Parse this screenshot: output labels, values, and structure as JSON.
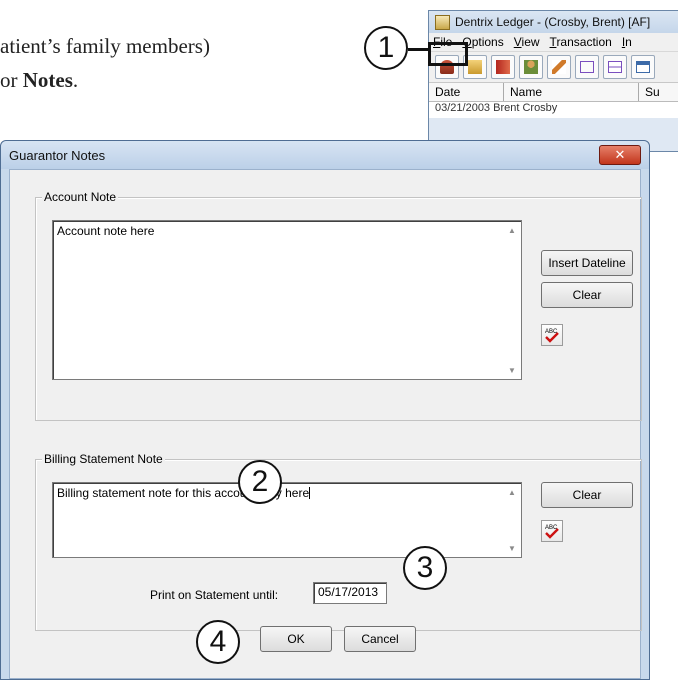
{
  "manual": {
    "line1": "atient’s family members)",
    "line2_prefix": "or ",
    "line2_bold": "Notes",
    "line2_suffix": "."
  },
  "callouts": [
    "1",
    "2",
    "3",
    "4"
  ],
  "ledger": {
    "title": "Dentrix Ledger - (Crosby, Brent) [AF]",
    "menu": [
      {
        "mnemonic": "F",
        "rest": "ile"
      },
      {
        "mnemonic": "O",
        "rest": "ptions"
      },
      {
        "mnemonic": "V",
        "rest": "iew"
      },
      {
        "mnemonic": "T",
        "rest": "ransaction"
      },
      {
        "mnemonic": "I",
        "rest": "n"
      }
    ],
    "toolbar_icons": [
      "patient-icon",
      "folder-icon",
      "book-icon",
      "person-icon",
      "pencil-icon",
      "form-icon",
      "note-icon",
      "calendar-icon"
    ],
    "columns": [
      "Date",
      "Name",
      "Su"
    ],
    "row": "03/21/2003  Brent Crosby"
  },
  "dialog": {
    "title": "Guarantor Notes",
    "close": "✕",
    "account_group": "Account Note",
    "account_note": "Account note here",
    "insert_dateline": "Insert Dateline",
    "clear": "Clear",
    "billing_group": "Billing Statement Note",
    "billing_note": "Billing statement note for this account only here",
    "print_label": "Print on Statement until:",
    "print_until": "05/17/2013",
    "ok": "OK",
    "cancel": "Cancel",
    "spell_icon": "spell-check-icon",
    "spell_text": "ABC"
  },
  "colors": {
    "dialog_frame": "#c8d9ec",
    "close_button": "#c2361c",
    "spell_check": "#cc1111"
  }
}
